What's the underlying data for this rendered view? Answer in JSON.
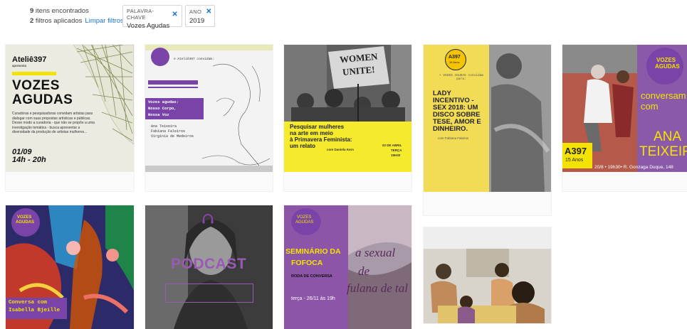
{
  "results": {
    "count": "9",
    "count_suffix": " itens encontrados",
    "filters_count": "2",
    "filters_suffix": " filtros aplicados",
    "clear_label": "Limpar filtros"
  },
  "filters": [
    {
      "key": "PALAVRA-CHAVE",
      "value": "Vozes Agudas"
    },
    {
      "key": "ANO",
      "value": "2019"
    }
  ],
  "cards": {
    "c1": {
      "brand": "Ateliê397",
      "brand_sub": "apresenta",
      "title1": "VOZES",
      "title2": "AGUDAS",
      "date": "01/09",
      "time": "14h - 20h",
      "body": "Curadoras e pesquisadoras convidam artistas para dialogar com suas propostas artísticas e públicas. Desse modo a curadoria - que não se propõe a uma investigação temática - busca apresentar a diversidade da produção de artistas mulheres..."
    },
    "c2": {
      "invite": "e Ateliê397 convidam:",
      "t1": "Vozes agudas:",
      "t2": "Nosso Corpo,",
      "t3": "Nossa Voz",
      "names1": "Ana Teixeira",
      "names2": "Fabiana Faleiros",
      "names3": "Virgínia de Medeiros"
    },
    "c3": {
      "sign1": "WOMEN",
      "sign2": "UNITE!",
      "title1": "Pesquisar mulheres",
      "title2": "na arte em meio",
      "title3": "à Primavera Feminista:",
      "title4": "um relato",
      "speaker": "com Daniela Kern",
      "date1": "02 DE ABRIL",
      "date2": "TERÇA",
      "date3": "19H30"
    },
    "c4": {
      "badge1": "A397",
      "badge2": "15 Anos",
      "sub": "+ VOZES AGUDAS convidam para:",
      "title1": "LADY",
      "title2": "INCENTIVO -",
      "title3": "SEX 2018: UM",
      "title4": "DISCO SOBRE",
      "title5": "TESE, AMOR E",
      "title6": "DINHEIRO.",
      "speaker": "com Fabiana Faleiros"
    },
    "c5": {
      "badge1": "VOZES",
      "badge2": "AGUDAS",
      "t1": "conversam",
      "t2": "com",
      "name1": "ANA",
      "name2": "TEIXEIRA",
      "logo1": "A397",
      "logo2": "15 Anos",
      "footer": "20/8 • 19h30• R. Gonzaga Duque, 148"
    },
    "c6": {
      "badge1": "VOZES",
      "badge2": "AGUDAS",
      "t1": "Conversa com",
      "t2": "Isabella Bjeille"
    },
    "c7": {
      "title": "PODCAST"
    },
    "c8": {
      "badge1": "VOZES",
      "badge2": "AGUDAS",
      "t1": "SEMINÁRIO DA",
      "t2": "FOFOCA",
      "sub": "RODA DE CONVERSA",
      "date": "terça - 26/11 às 19h",
      "script1": "a sexual",
      "script2": "de",
      "script3": "fulana de tal"
    },
    "c9": {}
  }
}
